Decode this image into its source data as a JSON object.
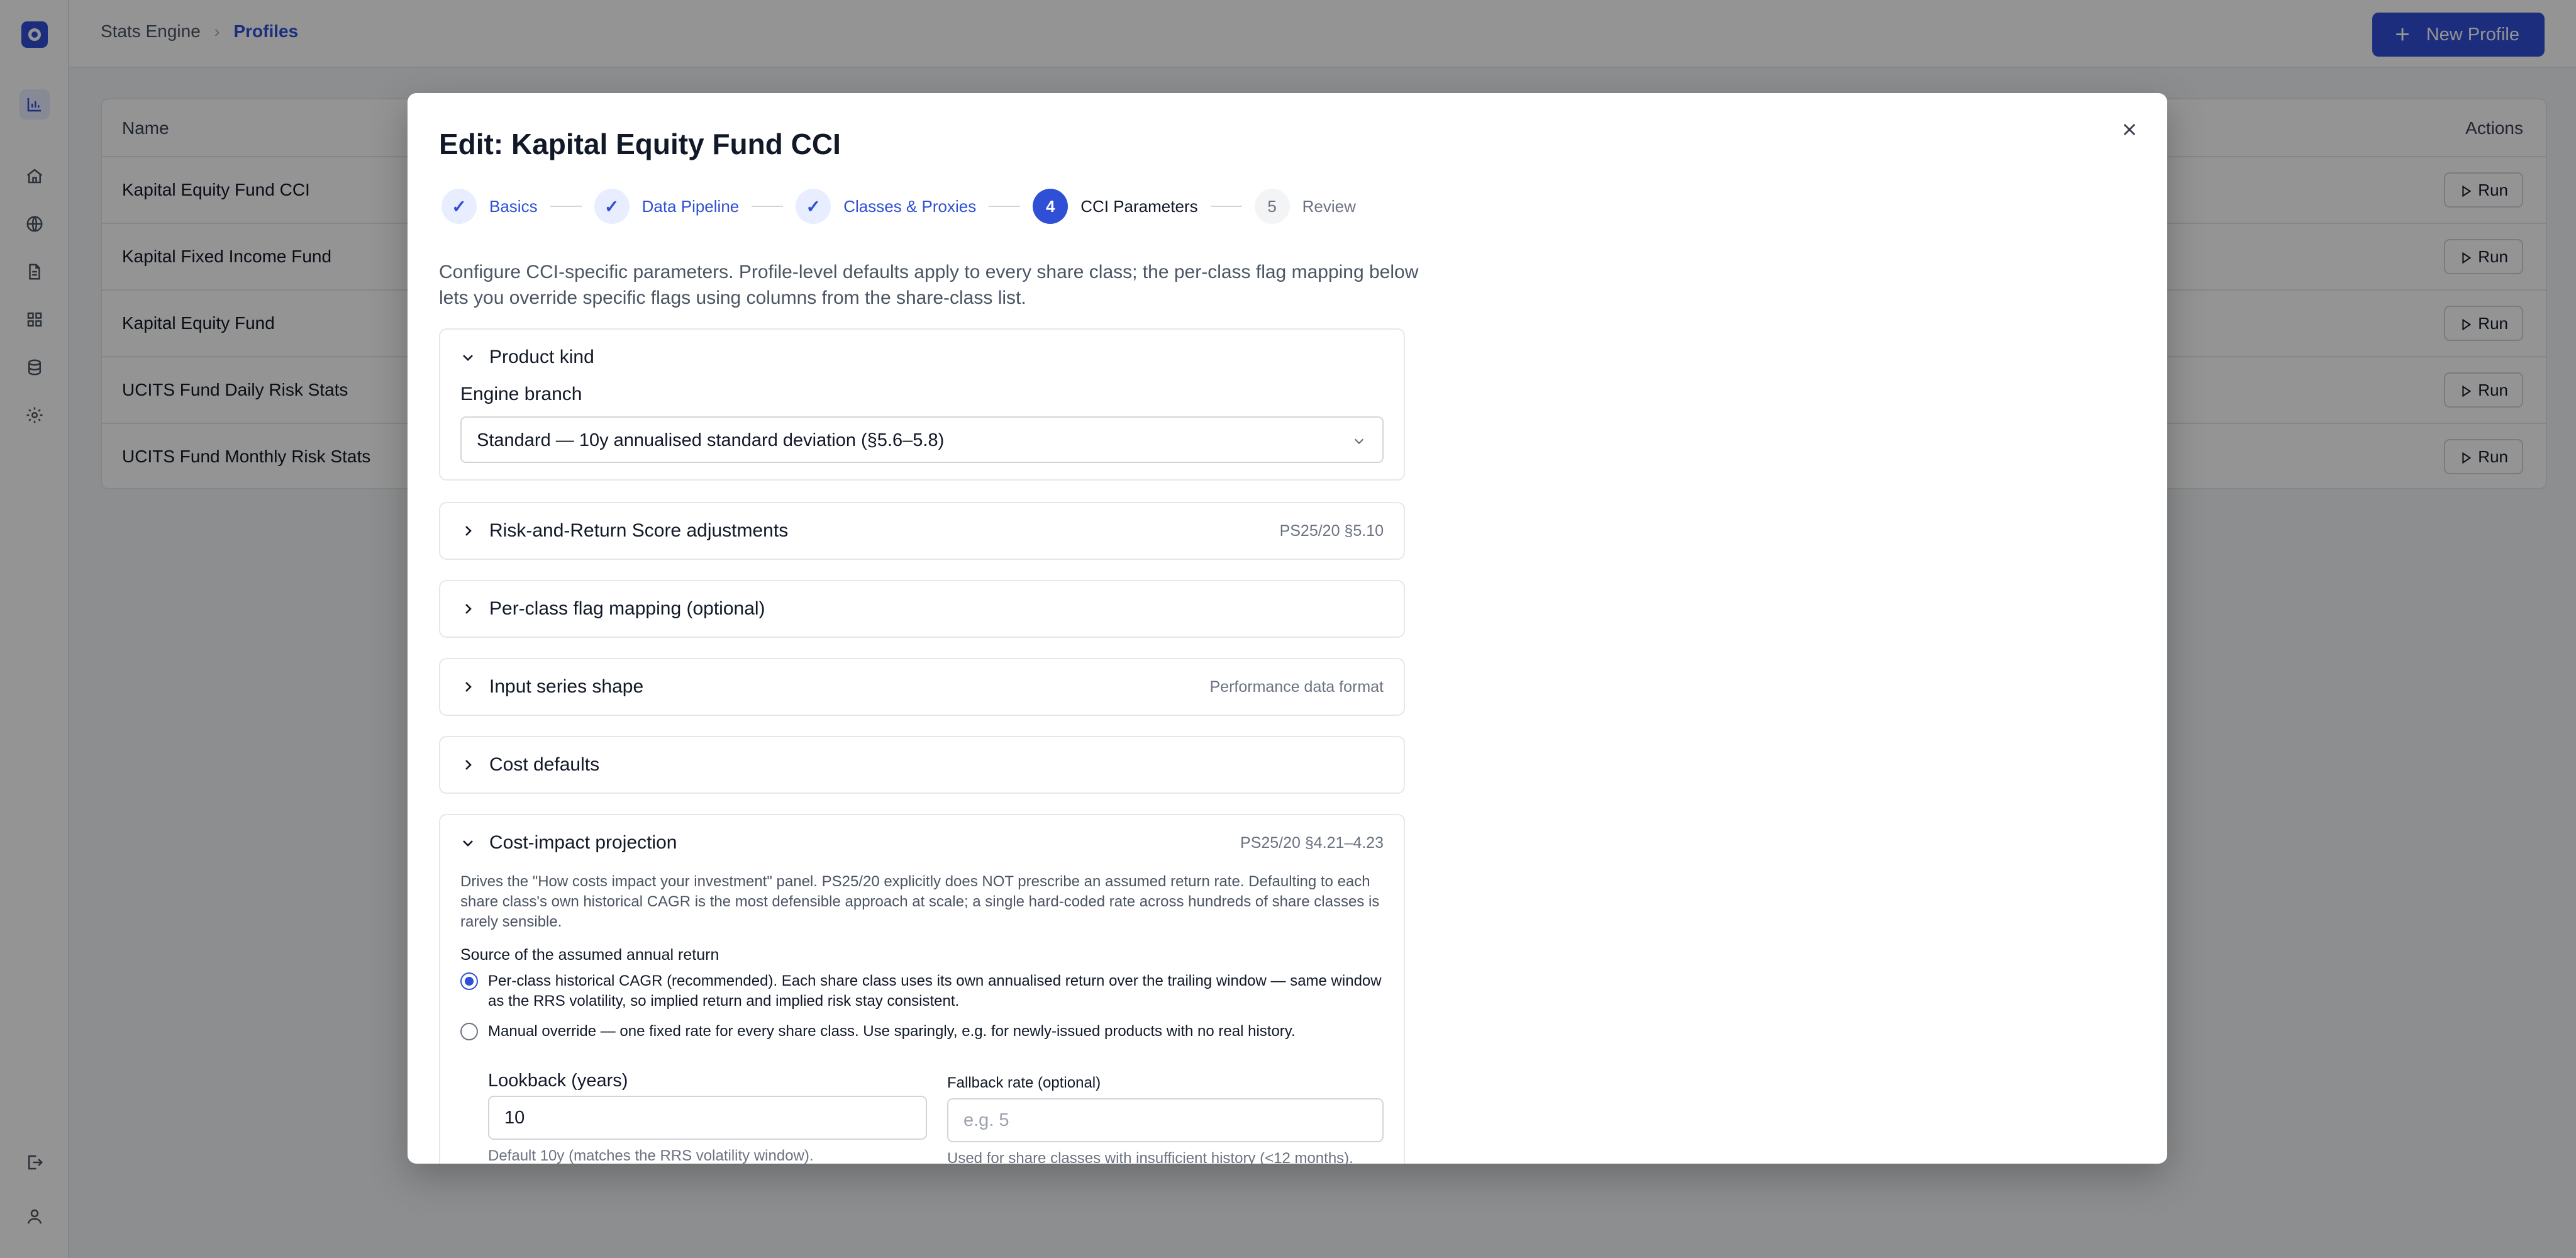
{
  "app": {
    "breadcrumb": {
      "root": "Stats Engine",
      "current": "Profiles"
    },
    "new_profile_label": "New Profile"
  },
  "table": {
    "headers": {
      "name": "Name",
      "actions": "Actions"
    },
    "rows": [
      {
        "name": "Kapital Equity Fund CCI",
        "action": "Run"
      },
      {
        "name": "Kapital Fixed Income Fund",
        "action": "Run"
      },
      {
        "name": "Kapital Equity Fund",
        "action": "Run"
      },
      {
        "name": "UCITS Fund Daily Risk Stats",
        "action": "Run"
      },
      {
        "name": "UCITS Fund Monthly Risk Stats",
        "action": "Run"
      }
    ]
  },
  "modal": {
    "title": "Edit: Kapital Equity Fund CCI",
    "steps": [
      {
        "label": "Basics",
        "marker": "✓",
        "state": "done"
      },
      {
        "label": "Data Pipeline",
        "marker": "✓",
        "state": "done"
      },
      {
        "label": "Classes & Proxies",
        "marker": "✓",
        "state": "done"
      },
      {
        "label": "CCI Parameters",
        "marker": "4",
        "state": "current"
      },
      {
        "label": "Review",
        "marker": "5",
        "state": "future"
      }
    ],
    "intro": "Configure CCI-specific parameters. Profile-level defaults apply to every share class; the per-class flag mapping below lets you override specific flags using columns from the share-class list.",
    "product_kind": {
      "title": "Product kind",
      "engine_branch_label": "Engine branch",
      "engine_branch_value": "Standard — 10y annualised standard deviation (§5.6–5.8)"
    },
    "risk_return": {
      "title": "Risk-and-Return Score adjustments",
      "meta": "PS25/20 §5.10"
    },
    "flag_mapping": {
      "title": "Per-class flag mapping (optional)"
    },
    "input_series": {
      "title": "Input series shape",
      "meta": "Performance data format"
    },
    "cost_defaults": {
      "title": "Cost defaults"
    },
    "cost_impact": {
      "title": "Cost-impact projection",
      "meta": "PS25/20 §4.21–4.23",
      "description": "Drives the \"How costs impact your investment\" panel. PS25/20 explicitly does NOT prescribe an assumed return rate. Defaulting to each share class's own historical CAGR is the most defensible approach at scale; a single hard-coded rate across hundreds of share classes is rarely sensible.",
      "source_label": "Source of the assumed annual return",
      "option_cagr": "Per-class historical CAGR (recommended). Each share class uses its own annualised return over the trailing window — same window as the RRS volatility, so implied return and implied risk stay consistent.",
      "option_manual": "Manual override — one fixed rate for every share class. Use sparingly, e.g. for newly-issued products with no real history.",
      "lookback_label": "Lookback (years)",
      "lookback_value": "10",
      "lookback_hint": "Default 10y (matches the RRS volatility window).",
      "fallback_label": "Fallback rate (optional)",
      "fallback_placeholder": "e.g. 5",
      "fallback_hint": "Used for share classes with insufficient history (<12 months)."
    }
  },
  "colors": {
    "accent": "#2f4fd6",
    "accent_soft": "#e8edff",
    "border": "#e5e7eb",
    "overlay": "rgba(0,0,0,0.42)"
  }
}
